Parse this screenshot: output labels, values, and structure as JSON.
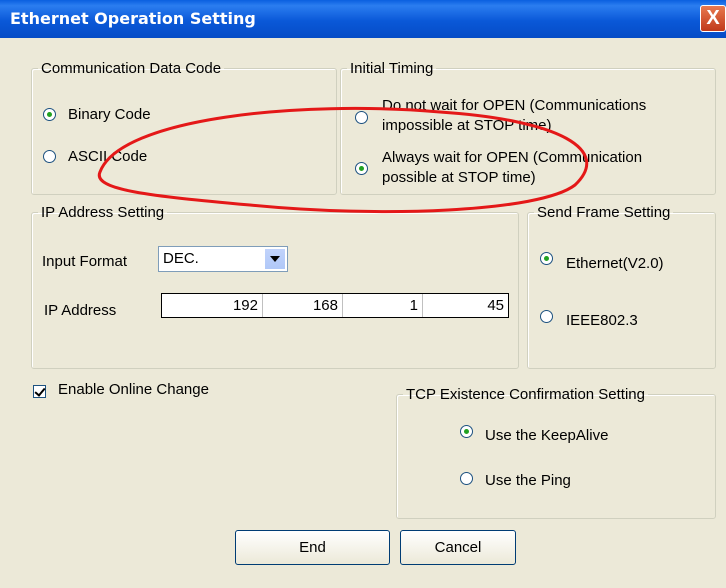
{
  "window": {
    "title": "Ethernet Operation Setting",
    "close_glyph": "X"
  },
  "data_code": {
    "legend": "Communication Data Code",
    "options": [
      {
        "label": "Binary Code",
        "checked": true
      },
      {
        "label": "ASCII Code",
        "checked": false
      }
    ]
  },
  "initial_timing": {
    "legend": "Initial Timing",
    "options": [
      {
        "line1": "Do not wait for OPEN (Communications",
        "line2": "impossible at STOP time)",
        "checked": false
      },
      {
        "line1": "Always wait for OPEN (Communication",
        "line2": "possible at STOP time)",
        "checked": true
      }
    ]
  },
  "ip_setting": {
    "legend": "IP Address Setting",
    "input_format_label": "Input Format",
    "input_format_value": "DEC.",
    "ip_label": "IP Address",
    "octets": [
      "192",
      "168",
      "1",
      "45"
    ]
  },
  "send_frame": {
    "legend": "Send Frame Setting",
    "options": [
      {
        "label": "Ethernet(V2.0)",
        "checked": true
      },
      {
        "label": "IEEE802.3",
        "checked": false
      }
    ]
  },
  "online_change": {
    "label": "Enable Online Change",
    "checked": true
  },
  "tcp_confirm": {
    "legend": "TCP Existence Confirmation Setting",
    "options": [
      {
        "label": "Use the KeepAlive",
        "checked": true
      },
      {
        "label": "Use the Ping",
        "checked": false
      }
    ]
  },
  "buttons": {
    "end": "End",
    "cancel": "Cancel"
  },
  "colors": {
    "annotation": "#e41818",
    "titlebar": "#0a58d8"
  }
}
